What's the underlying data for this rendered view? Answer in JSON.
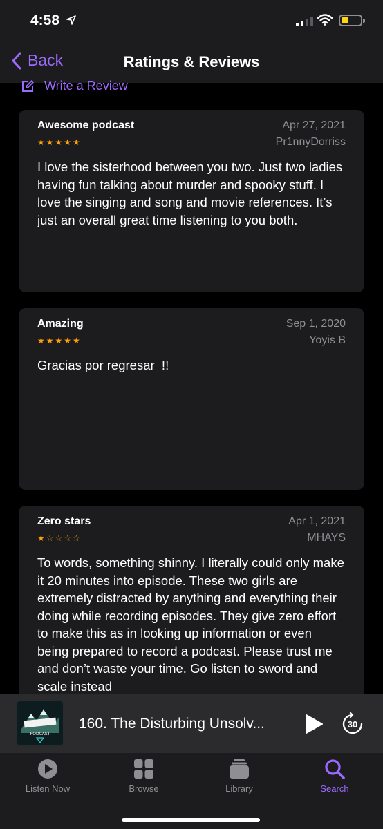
{
  "status": {
    "time": "4:58",
    "icons": [
      "location-arrow-icon",
      "signal-icon",
      "wifi-icon",
      "battery-icon"
    ]
  },
  "nav": {
    "back_label": "Back",
    "title": "Ratings & Reviews",
    "back_icon": "chevron-left-icon"
  },
  "write_review": {
    "label": "Write a Review",
    "icon": "compose-icon"
  },
  "reviews": [
    {
      "title": "Awesome podcast",
      "date": "Apr 27, 2021",
      "author": "Pr1nnyDorriss",
      "stars": "★★★★★",
      "rating": 5,
      "body": "I love the sisterhood between you two. Just two ladies having fun talking about murder and spooky stuff. I love the singing and song and movie references. It’s just an overall great time listening to you both."
    },
    {
      "title": "Amazing",
      "date": "Sep 1, 2020",
      "author": "Yoyis B",
      "stars": "★★★★★",
      "rating": 5,
      "body": "Gracias por regresar  !!"
    },
    {
      "title": "Zero stars",
      "date": "Apr 1, 2021",
      "author": "MHAYS",
      "stars": "★☆☆☆☆",
      "rating": 1,
      "body": "To words, something shinny. I literally could only make it 20 minutes into episode. These two girls are extremely distracted by anything and everything their doing while recording episodes. They give zero effort to make this as in looking up information or even being prepared to record a podcast. Please trust me and don’t waste your time. Go listen to sword and scale instead"
    }
  ],
  "player": {
    "track": "160. The Disturbing Unsolv...",
    "skip_seconds": "30",
    "artwork_text": "PODCAST"
  },
  "tabs": [
    {
      "label": "Listen Now",
      "icon": "play-circle-icon",
      "active": false
    },
    {
      "label": "Browse",
      "icon": "grid-icon",
      "active": false
    },
    {
      "label": "Library",
      "icon": "stack-icon",
      "active": false
    },
    {
      "label": "Search",
      "icon": "magnifier-icon",
      "active": true
    }
  ],
  "colors": {
    "accent": "#9d6aff",
    "star": "#ff9f0a",
    "card": "#1c1c1e",
    "secondary_text": "#8e8e93"
  }
}
